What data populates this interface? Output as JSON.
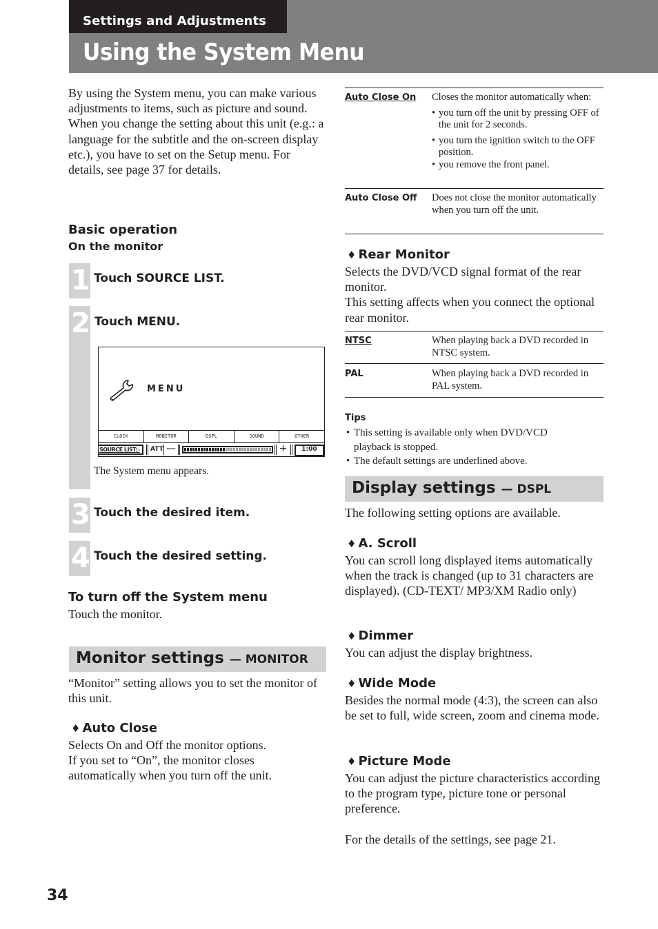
{
  "header": {
    "section": "Settings and Adjustments",
    "title": "Using the System Menu"
  },
  "intro": {
    "p1": "By using the System menu, you can make various adjustments to items, such as picture and sound.",
    "p2": "When you change the setting about this unit (e.g.: a language for the subtitle and the on-screen display etc.), you have to set on the Setup menu. For details, see page 37 for details."
  },
  "basic_operation": {
    "heading": "Basic operation",
    "subheading": "On the monitor",
    "steps": [
      {
        "number": "1",
        "label": "Touch SOURCE LIST."
      },
      {
        "number": "2",
        "label": "Touch MENU."
      },
      {
        "number": "3",
        "label": "Touch the desired item."
      },
      {
        "number": "4",
        "label": "Touch the desired setting."
      }
    ],
    "caption": "The System menu appears."
  },
  "screen": {
    "icon": "wrench-icon",
    "menu_label": "MENU",
    "tabs": [
      "CLOCK",
      "MONITOR",
      "DSPL",
      "SOUND",
      "OTHER"
    ],
    "source_list_label": "SOURCE LIST▷",
    "att_label": "ATT",
    "minus_label": "—",
    "plus_label": "+",
    "volume_level_segments": 15,
    "volume_total_segments": 32,
    "time": "1:00"
  },
  "turn_off": {
    "heading": "To turn off the System menu",
    "text": "Touch the monitor."
  },
  "monitor_settings": {
    "heading": "Monitor settings",
    "code": "— MONITOR",
    "intro": "“Monitor” setting allows you to set the monitor of this unit.",
    "auto_close": {
      "heading": "Auto Close",
      "text1": "Selects On and Off the monitor options.",
      "text2": "If you set to “On”, the monitor closes automatically when you turn off the unit.",
      "options": [
        {
          "key": "Auto Close On",
          "default": true,
          "desc": "Closes the monitor automatically when:",
          "bullets": [
            "you turn off the unit by pressing OFF of the unit for 2 seconds.",
            "you turn the ignition switch to the OFF position.",
            "you remove the front panel."
          ]
        },
        {
          "key": "Auto Close Off",
          "default": false,
          "desc": "Does not close the monitor automatically when you turn off the unit."
        }
      ]
    },
    "rear_monitor": {
      "heading": "Rear Monitor",
      "text1": "Selects the DVD/VCD signal format of the rear monitor.",
      "text2": "This setting affects when you connect the optional rear monitor.",
      "options": [
        {
          "key": "NTSC",
          "default": true,
          "desc": "When playing back a DVD recorded in NTSC system."
        },
        {
          "key": "PAL",
          "default": false,
          "desc": "When playing back a DVD recorded in PAL system."
        }
      ]
    },
    "tips": {
      "heading": "Tips",
      "items": [
        "This setting is available only when DVD/VCD playback is stopped.",
        "The default settings are underlined above."
      ]
    }
  },
  "display_settings": {
    "heading": "Display settings",
    "code": "— DSPL",
    "intro": "The following setting options are available.",
    "items": [
      {
        "heading": "A. Scroll",
        "text": "You can scroll long displayed items automatically when the track is changed (up to 31 characters are displayed). (CD-TEXT/ MP3/XM Radio only)"
      },
      {
        "heading": "Dimmer",
        "text": "You can adjust the display brightness."
      },
      {
        "heading": "Wide Mode",
        "text": "Besides the normal mode (4:3), the screen can also be set to full, wide screen, zoom and cinema mode."
      },
      {
        "heading": "Picture Mode",
        "text": "You can adjust the picture characteristics according to the program type, picture tone or personal preference."
      }
    ],
    "footer": "For the details of the settings, see page 21."
  },
  "diamond_glyph": "♦",
  "bullet_glyph": "•",
  "page_number": "34",
  "colors": {
    "header_band": "#808083",
    "section_tab": "#231f20",
    "heading_band": "#d1d2d4",
    "text": "#231f20"
  }
}
